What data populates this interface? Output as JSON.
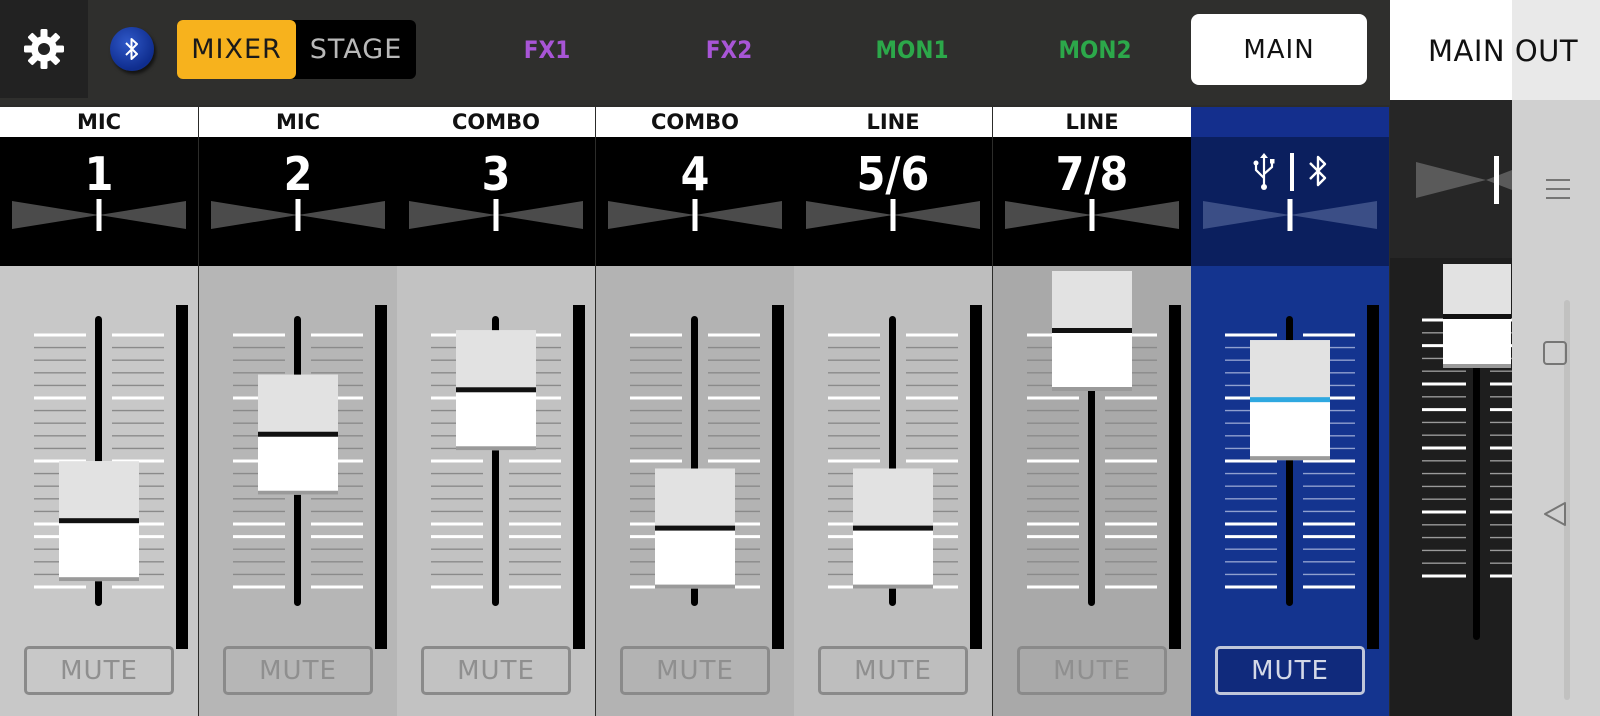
{
  "toolbar": {
    "settings_icon": "gear-icon",
    "bluetooth_icon": "bluetooth-icon",
    "mode_mixer": "MIXER",
    "mode_stage": "STAGE",
    "bus_fx1": "FX1",
    "bus_fx2": "FX2",
    "bus_mon1": "MON1",
    "bus_mon2": "MON2",
    "bus_main": "MAIN",
    "main_out_label": "MAIN OUT"
  },
  "colors": {
    "fx": "#a855d6",
    "mon": "#2ca84a",
    "accent": "#f7b21d",
    "usb_channel": "#14348f",
    "usb_fader_line": "#2fa8e0"
  },
  "channels": [
    {
      "type": "MIC",
      "number": "1",
      "level": 0.23,
      "mute": "MUTE"
    },
    {
      "type": "MIC",
      "number": "2",
      "level": 0.58,
      "mute": "MUTE"
    },
    {
      "type": "COMBO",
      "number": "3",
      "level": 0.76,
      "mute": "MUTE"
    },
    {
      "type": "COMBO",
      "number": "4",
      "level": 0.2,
      "mute": "MUTE"
    },
    {
      "type": "LINE",
      "number": "5/6",
      "level": 0.2,
      "mute": "MUTE"
    },
    {
      "type": "LINE",
      "number": "7/8",
      "level": 1.0,
      "mute": "MUTE"
    },
    {
      "type": "",
      "number": "",
      "icons": [
        "usb-icon",
        "bluetooth-icon"
      ],
      "level": 0.72,
      "mute": "MUTE"
    }
  ],
  "main_out": {
    "level": 1.0
  },
  "android_nav": {
    "menu_icon": "menu-icon",
    "home_icon": "square-home-icon",
    "back_icon": "triangle-back-icon"
  }
}
